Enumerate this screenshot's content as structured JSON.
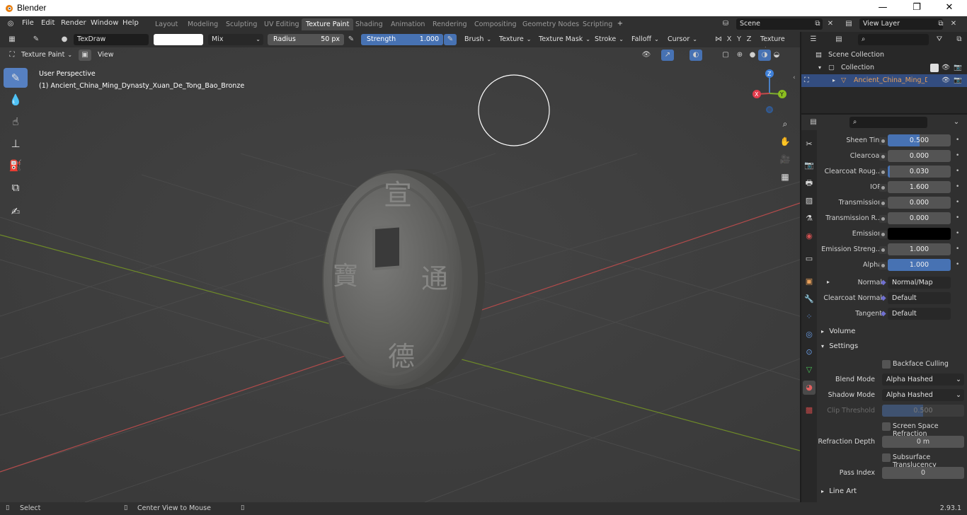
{
  "window": {
    "title": "Blender",
    "minimize": "—",
    "maximize": "❐",
    "close": "✕"
  },
  "menu": [
    "File",
    "Edit",
    "Render",
    "Window",
    "Help"
  ],
  "workspaces": [
    "Layout",
    "Modeling",
    "Sculpting",
    "UV Editing",
    "Texture Paint",
    "Shading",
    "Animation",
    "Rendering",
    "Compositing",
    "Geometry Nodes",
    "Scripting"
  ],
  "active_workspace": "Texture Paint",
  "scene": {
    "name": "Scene",
    "view_layer": "View Layer"
  },
  "tool_header": {
    "brush_name": "TexDraw",
    "blend": "Mix",
    "radius_label": "Radius",
    "radius_value": "50 px",
    "strength_label": "Strength",
    "strength_value": "1.000",
    "strength_fraction": 1.0,
    "dropdowns": [
      "Brush",
      "Texture",
      "Texture Mask",
      "Stroke",
      "Falloff",
      "Cursor"
    ],
    "axes": [
      "X",
      "Y",
      "Z"
    ],
    "texture_slots": "Texture Slots"
  },
  "viewport_header": {
    "mode": "Texture Paint",
    "view": "View"
  },
  "viewport": {
    "perspective": "User Perspective",
    "object_label": "(1) Ancient_China_Ming_Dynasty_Xuan_De_Tong_Bao_Bronze",
    "gizmo": {
      "x": "X",
      "y": "Y",
      "z": "Z"
    },
    "coin_chars": [
      "宣",
      "通",
      "德",
      "寶"
    ]
  },
  "outliner": {
    "scene_collection": "Scene Collection",
    "collection": "Collection",
    "object": "Ancient_China_Ming_Dyr"
  },
  "properties": {
    "rows": [
      {
        "label": "Sheen Tint",
        "value": "0.500",
        "fill": 0.5
      },
      {
        "label": "Clearcoat",
        "value": "0.000",
        "fill": 0
      },
      {
        "label": "Clearcoat Roug...",
        "value": "0.030",
        "fill": 0.03
      },
      {
        "label": "IOR",
        "value": "1.600",
        "fill": 0
      },
      {
        "label": "Transmission",
        "value": "0.000",
        "fill": 0
      },
      {
        "label": "Transmission R...",
        "value": "0.000",
        "fill": 0
      },
      {
        "label": "Emission",
        "value": "",
        "fill": 0,
        "color": "#000000"
      },
      {
        "label": "Emission Streng...",
        "value": "1.000",
        "fill": 0
      },
      {
        "label": "Alpha",
        "value": "1.000",
        "fill": 1.0
      }
    ],
    "normal": {
      "label": "Normal",
      "value": "Normal/Map"
    },
    "clearcoat_normal": {
      "label": "Clearcoat Normal",
      "value": "Default"
    },
    "tangent": {
      "label": "Tangent",
      "value": "Default"
    },
    "volume": "Volume",
    "settings": "Settings",
    "backface_culling": "Backface Culling",
    "blend_mode": {
      "label": "Blend Mode",
      "value": "Alpha Hashed"
    },
    "shadow_mode": {
      "label": "Shadow Mode",
      "value": "Alpha Hashed"
    },
    "clip_threshold": {
      "label": "Clip Threshold",
      "value": "0.500",
      "fill": 0.5
    },
    "screen_space_refraction": "Screen Space Refraction",
    "refraction_depth": {
      "label": "Refraction Depth",
      "value": "0 m"
    },
    "subsurface_translucency": "Subsurface Translucency",
    "pass_index": {
      "label": "Pass Index",
      "value": "0"
    },
    "line_art": "Line Art"
  },
  "statusbar": {
    "select": "Select",
    "center": "Center View to Mouse",
    "version": "2.93.1"
  },
  "colors": {
    "accent": "#4772b3",
    "active_tool": "#5680c2",
    "x_axis": "#b34b4b",
    "y_axis": "#6e8a28",
    "object_orange": "#e8a05a"
  }
}
